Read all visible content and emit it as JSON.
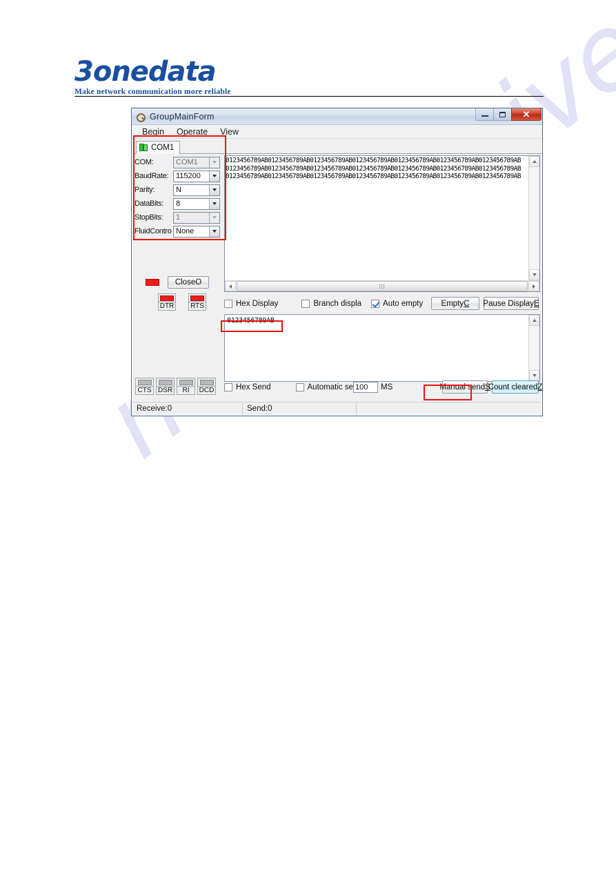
{
  "brand": {
    "name": "3onedata",
    "tagline": "Make network communication more reliable"
  },
  "watermark": {
    "text": "manualshive.com"
  },
  "window": {
    "title": "GroupMainForm",
    "icon": "serial-port-icon",
    "buttons": {
      "minimize": "minimize-icon",
      "maximize": "maximize-icon",
      "close": "✕"
    }
  },
  "menu": {
    "items": [
      {
        "label": "Begin"
      },
      {
        "label": "Operate"
      },
      {
        "label": "View"
      }
    ]
  },
  "tabs": [
    {
      "label": "COM1",
      "icon": "green-flag-icon",
      "active": true
    }
  ],
  "settings": {
    "rows": [
      {
        "label": "COM:",
        "value": "COM1",
        "disabled": true
      },
      {
        "label": "BaudRate:",
        "value": "115200",
        "disabled": false
      },
      {
        "label": "Parity:",
        "value": "N",
        "disabled": false
      },
      {
        "label": "DataBits:",
        "value": "8",
        "disabled": false
      },
      {
        "label": "StopBits:",
        "value": "1",
        "disabled": true
      },
      {
        "label": "FluidContro",
        "value": "None",
        "disabled": false
      }
    ]
  },
  "connection": {
    "led": "port-open-led",
    "close_button": "CloseO",
    "signals": [
      {
        "label": "DTR",
        "on": true
      },
      {
        "label": "RTS",
        "on": true
      }
    ]
  },
  "modem_status": [
    {
      "label": "CTS",
      "on": false
    },
    {
      "label": "DSR",
      "on": false
    },
    {
      "label": "RI",
      "on": false
    },
    {
      "label": "DCD",
      "on": false
    }
  ],
  "receive": {
    "lines": [
      "0123456789AB0123456789AB0123456789AB0123456789AB0123456789AB0123456789AB0123456789AB",
      "0123456789AB0123456789AB0123456789AB0123456789AB0123456789AB0123456789AB0123456789AB",
      "0123456789AB0123456789AB0123456789AB0123456789AB0123456789AB0123456789AB0123456789AB"
    ],
    "text": "0123456789AB0123456789AB0123456789AB0123456789AB0123456789AB0123456789AB0123456789AB\n0123456789AB0123456789AB0123456789AB0123456789AB0123456789AB0123456789AB0123456789AB\n0123456789AB0123456789AB0123456789AB0123456789AB0123456789AB0123456789AB0123456789AB"
  },
  "receive_options": {
    "hex_display": {
      "label": "Hex Display",
      "checked": false
    },
    "branch_display": {
      "label": "Branch displa",
      "checked": false
    },
    "auto_empty": {
      "label": "Auto empty",
      "checked": true
    },
    "empty_button": {
      "label": "EmptyC",
      "text": "Empty",
      "accel": "C"
    },
    "pause_button": {
      "label": "Pause DisplayE",
      "text": "Pause Display",
      "accel": "E"
    }
  },
  "send": {
    "value": "0123456789AB",
    "hex_send": {
      "label": "Hex Send",
      "checked": false
    },
    "automatic": {
      "label": "Automatic se",
      "checked": false
    },
    "interval": "100",
    "interval_unit": "MS",
    "manual_button": {
      "label": "Manual sendS",
      "text": "Manual send",
      "accel": "S"
    },
    "count_button": {
      "label": "Count clearedZ",
      "text": "Count cleared",
      "accel": "Z"
    }
  },
  "statusbar": {
    "receive_count": "Receive:0",
    "send_count": "Send:0",
    "extra": ""
  },
  "annotations": {
    "accent_color": "#f01010",
    "boxes": [
      "settings-panel",
      "send-text-field",
      "manual-send-button"
    ]
  }
}
